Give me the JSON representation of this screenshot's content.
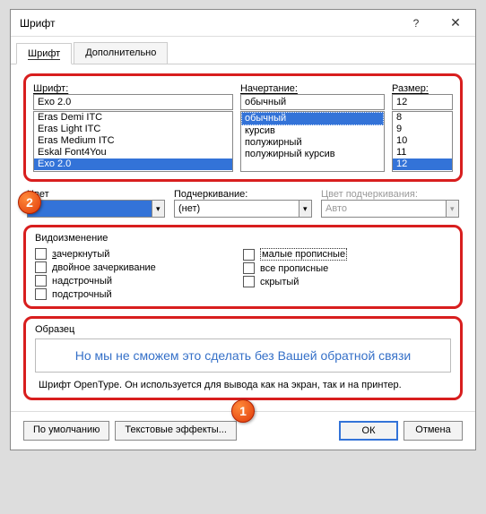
{
  "dialog": {
    "title": "Шрифт"
  },
  "tabs": {
    "t1": "Шрифт",
    "t2": "Дополнительно"
  },
  "labels": {
    "font": "Шрифт:",
    "style": "Начертание:",
    "size": "Размер:",
    "textcolor": "Цвет",
    "underline": "Подчеркивание:",
    "ulcolor": "Цвет подчеркивания:",
    "effects": "Видоизменение",
    "sample": "Образец"
  },
  "font": {
    "value": "Exo 2.0",
    "items": [
      "Eras Demi ITC",
      "Eras Light ITC",
      "Eras Medium ITC",
      "Eskal Font4You",
      "Exo 2.0"
    ]
  },
  "style": {
    "value": "обычный",
    "items": [
      "обычный",
      "курсив",
      "полужирный",
      "полужирный курсив"
    ]
  },
  "size": {
    "value": "12",
    "items": [
      "8",
      "9",
      "10",
      "11",
      "12"
    ]
  },
  "underline_value": "(нет)",
  "ulcolor_value": "Авто",
  "effects": {
    "strike": "зачеркнутый",
    "dstrike": "двойное зачеркивание",
    "superscript": "надстрочный",
    "subscript": "подстрочный",
    "smallcaps": "малые прописные",
    "allcaps": "все прописные",
    "hidden": "скрытый"
  },
  "sample_text": "Но мы не сможем это сделать без Вашей обратной связи",
  "sample_info": "Шрифт OpenType. Он используется для вывода как на экран, так и на принтер.",
  "buttons": {
    "default": "По умолчанию",
    "texteffects": "Текстовые эффекты...",
    "ok": "ОК",
    "cancel": "Отмена"
  },
  "badges": {
    "b1": "1",
    "b2": "2"
  }
}
